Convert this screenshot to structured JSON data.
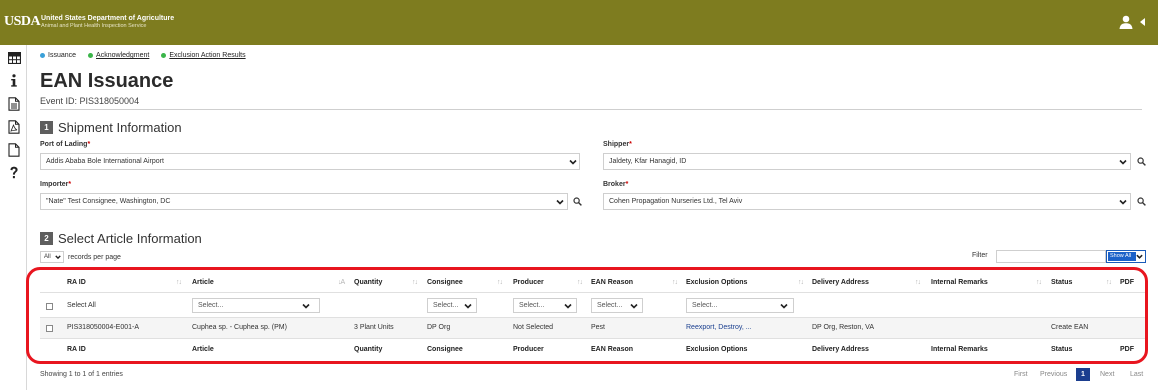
{
  "header": {
    "logo_text": "USDA",
    "agency_line1": "United States Department of Agriculture",
    "agency_line2": "Animal and Plant Health Inspection Service",
    "brand_color": "#7e7c1f"
  },
  "rail_icons": [
    "grid-icon",
    "info-icon",
    "document-icon",
    "pdf-icon",
    "blank-page-icon",
    "help-icon"
  ],
  "steps": [
    {
      "label": "Issuance",
      "dot_color": "#3aa0d8",
      "underlined": false
    },
    {
      "label": "Acknowledgment",
      "dot_color": "#3bb54a",
      "underlined": true
    },
    {
      "label": "Exclusion Action Results",
      "dot_color": "#3bb54a",
      "underlined": true
    }
  ],
  "page": {
    "title": "EAN Issuance",
    "event_id": "Event ID: PIS318050004"
  },
  "shipment": {
    "number": "1",
    "title": "Shipment Information",
    "port_label": "Port of Lading",
    "port_value": "Addis Ababa Bole International Airport",
    "shipper_label": "Shipper",
    "shipper_value": "Jaldety, Kfar Hanagid, ID",
    "importer_label": "Importer",
    "importer_value": "\"Nate\" Test Consignee, Washington, DC",
    "broker_label": "Broker",
    "broker_value": "Cohen Propagation Nurseries Ltd., Tel Aviv",
    "required_mark": "*"
  },
  "article": {
    "number": "2",
    "title": "Select Article Information",
    "page_length": "All",
    "records_label": "records per page",
    "filter_label": "Filter",
    "show_all": "Show All"
  },
  "table": {
    "columns": [
      "RA ID",
      "Article",
      "Quantity",
      "Consignee",
      "Producer",
      "EAN Reason",
      "Exclusion Options",
      "Delivery Address",
      "Internal Remarks",
      "Status",
      "PDF"
    ],
    "select_all": "Select All",
    "select_placeholder": "Select...",
    "select_short": "Select...",
    "row": {
      "ra_id": "PIS318050004-E001-A",
      "article": "Cuphea sp. - Cuphea sp. (PM)",
      "quantity": "3 Plant Units",
      "consignee": "DP Org",
      "producer": "Not Selected",
      "ean_reason": "Pest",
      "exclusion_options": "Reexport, Destroy, ...",
      "delivery_address": "DP Org, Reston, VA",
      "status": "Create EAN"
    }
  },
  "footer": {
    "showing": "Showing 1 to 1 of 1 entries",
    "first": "First",
    "previous": "Previous",
    "current_page": "1",
    "next": "Next",
    "last": "Last"
  },
  "colors": {
    "highlight": "#e8151f",
    "active_page": "#1b3e8f",
    "link": "#1a3f8f"
  }
}
